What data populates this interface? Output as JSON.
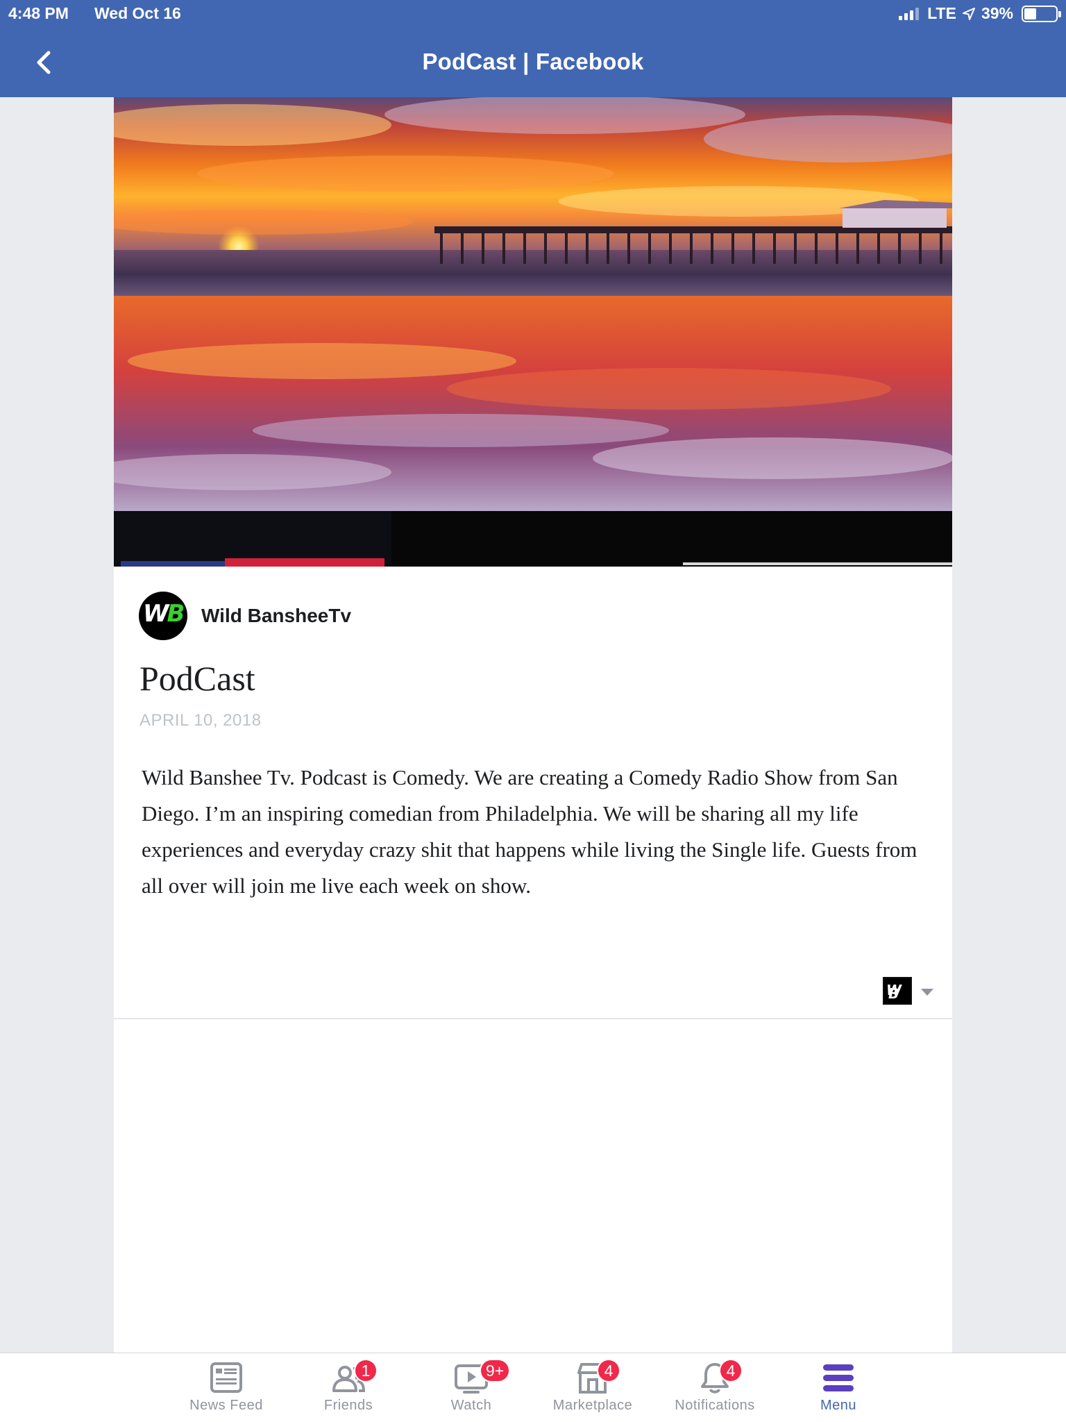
{
  "status_bar": {
    "time": "4:48 PM",
    "date": "Wed Oct 16",
    "network": "LTE",
    "battery": "39%"
  },
  "navbar": {
    "title": "PodCast | Facebook",
    "back_icon": "chevron-left-icon"
  },
  "post": {
    "hero_image": "Sunset over the ocean with a pier, colorful clouds reflected on wet sand",
    "author_name": "Wild BansheeTv",
    "avatar_text": "WB",
    "title": "PodCast",
    "date": "APRIL 10, 2018",
    "body": "Wild Banshee Tv. Podcast is Comedy. We are creating a Comedy Radio Show from San Diego. I’m an inspiring comedian from Philadelphia. We will be sharing all my life experiences and everyday crazy shit that happens while living the Single life. Guests from all over will join me live each week on show.",
    "page_logo_text": "WB"
  },
  "tabbar": {
    "tabs": [
      {
        "label": "News Feed",
        "icon": "news-feed-icon",
        "badge": ""
      },
      {
        "label": "Friends",
        "icon": "friends-icon",
        "badge": "1"
      },
      {
        "label": "Watch",
        "icon": "watch-icon",
        "badge": "9+"
      },
      {
        "label": "Marketplace",
        "icon": "marketplace-icon",
        "badge": "4"
      },
      {
        "label": "Notifications",
        "icon": "bell-icon",
        "badge": "4"
      },
      {
        "label": "Menu",
        "icon": "menu-icon",
        "badge": ""
      }
    ],
    "active_color": "#4267b2",
    "badge_color": "#f02849"
  },
  "colors": {
    "brand": "#4267b2",
    "background": "#e9ebee"
  }
}
